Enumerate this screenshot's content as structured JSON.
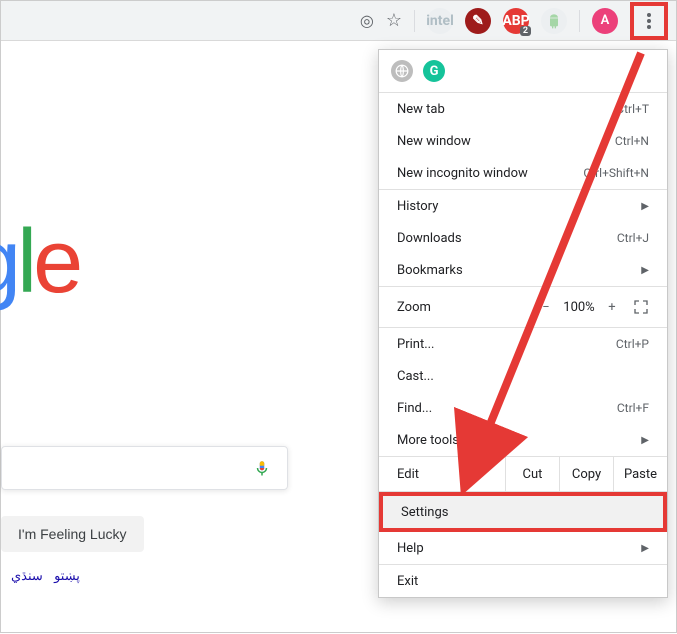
{
  "toolbar": {
    "abp_badge": "2",
    "avatar_letter": "A"
  },
  "page": {
    "search_placeholder": "",
    "lucky_button": "I'm Feeling Lucky",
    "rtl_link_1": "پښتو",
    "rtl_link_2": "سنڌي"
  },
  "menu": {
    "new_tab": {
      "label": "New tab",
      "shortcut": "Ctrl+T"
    },
    "new_window": {
      "label": "New window",
      "shortcut": "Ctrl+N"
    },
    "new_incognito": {
      "label": "New incognito window",
      "shortcut": "Ctrl+Shift+N"
    },
    "history": {
      "label": "History"
    },
    "downloads": {
      "label": "Downloads",
      "shortcut": "Ctrl+J"
    },
    "bookmarks": {
      "label": "Bookmarks"
    },
    "zoom": {
      "label": "Zoom",
      "value": "100%",
      "minus": "−",
      "plus": "+"
    },
    "print": {
      "label": "Print...",
      "shortcut": "Ctrl+P"
    },
    "cast": {
      "label": "Cast..."
    },
    "find": {
      "label": "Find...",
      "shortcut": "Ctrl+F"
    },
    "more_tools": {
      "label": "More tools"
    },
    "edit": {
      "label": "Edit",
      "cut": "Cut",
      "copy": "Copy",
      "paste": "Paste"
    },
    "settings": {
      "label": "Settings"
    },
    "help": {
      "label": "Help"
    },
    "exit": {
      "label": "Exit"
    }
  }
}
